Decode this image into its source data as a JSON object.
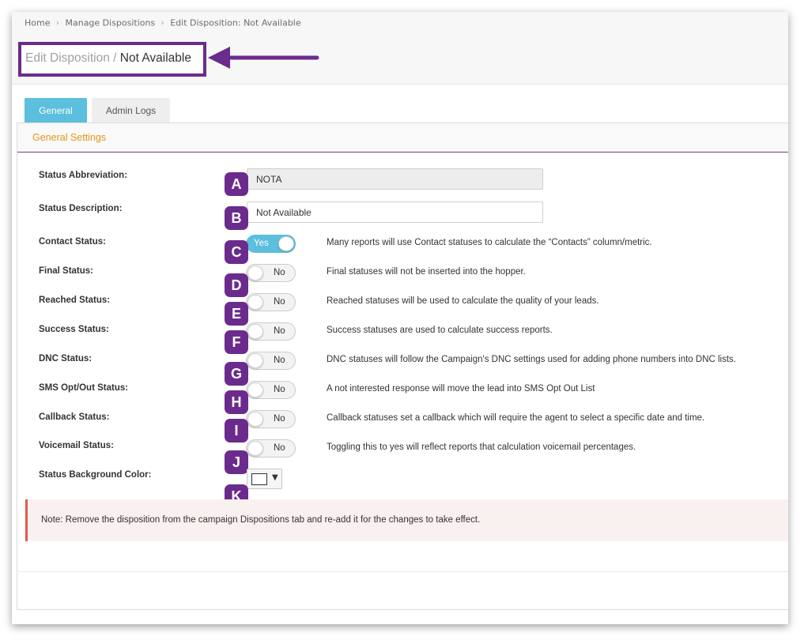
{
  "breadcrumb": {
    "home": "Home",
    "manage": "Manage Dispositions",
    "current": "Edit Disposition: Not Available",
    "separator": "›"
  },
  "title": {
    "prefix": "Edit Disposition /",
    "name": "Not Available"
  },
  "annotation_color": "#6b2b8c",
  "tabs": [
    {
      "label": "General",
      "active": true
    },
    {
      "label": "Admin Logs",
      "active": false
    }
  ],
  "panel": {
    "title": "General Settings"
  },
  "fields": {
    "abbreviation": {
      "label": "Status Abbreviation:",
      "value": "NOTA",
      "badge": "A"
    },
    "description": {
      "label": "Status Description:",
      "value": "Not Available",
      "badge": "B"
    }
  },
  "toggles": [
    {
      "label": "Contact Status:",
      "state": "Yes",
      "on": true,
      "badge": "C",
      "desc": "Many reports will use Contact statuses to calculate the “Contacts” column/metric."
    },
    {
      "label": "Final Status:",
      "state": "No",
      "on": false,
      "badge": "D",
      "desc": "Final statuses will not be inserted into the hopper."
    },
    {
      "label": "Reached Status:",
      "state": "No",
      "on": false,
      "badge": "E",
      "desc": "Reached statuses will be used to calculate the quality of your leads."
    },
    {
      "label": "Success Status:",
      "state": "No",
      "on": false,
      "badge": "F",
      "desc": "Success statuses are used to calculate success reports."
    },
    {
      "label": "DNC Status:",
      "state": "No",
      "on": false,
      "badge": "G",
      "desc": "DNC statuses will follow the Campaign's DNC settings used for adding phone numbers into DNC lists."
    },
    {
      "label": "SMS Opt/Out Status:",
      "state": "No",
      "on": false,
      "badge": "H",
      "desc": "A not interested response will move the lead into SMS Opt Out List"
    },
    {
      "label": "Callback Status:",
      "state": "No",
      "on": false,
      "badge": "I",
      "desc": "Callback statuses set a callback which will require the agent to select a specific date and time."
    },
    {
      "label": "Voicemail Status:",
      "state": "No",
      "on": false,
      "badge": "J",
      "desc": "Toggling this to yes will reflect reports that calculation voicemail percentages."
    }
  ],
  "color_field": {
    "label": "Status Background Color:",
    "badge": "K",
    "swatch": "#ffffff",
    "caret": "▼"
  },
  "note": "Note: Remove the disposition from the campaign Dispositions tab and re-add it for the changes to take effect."
}
